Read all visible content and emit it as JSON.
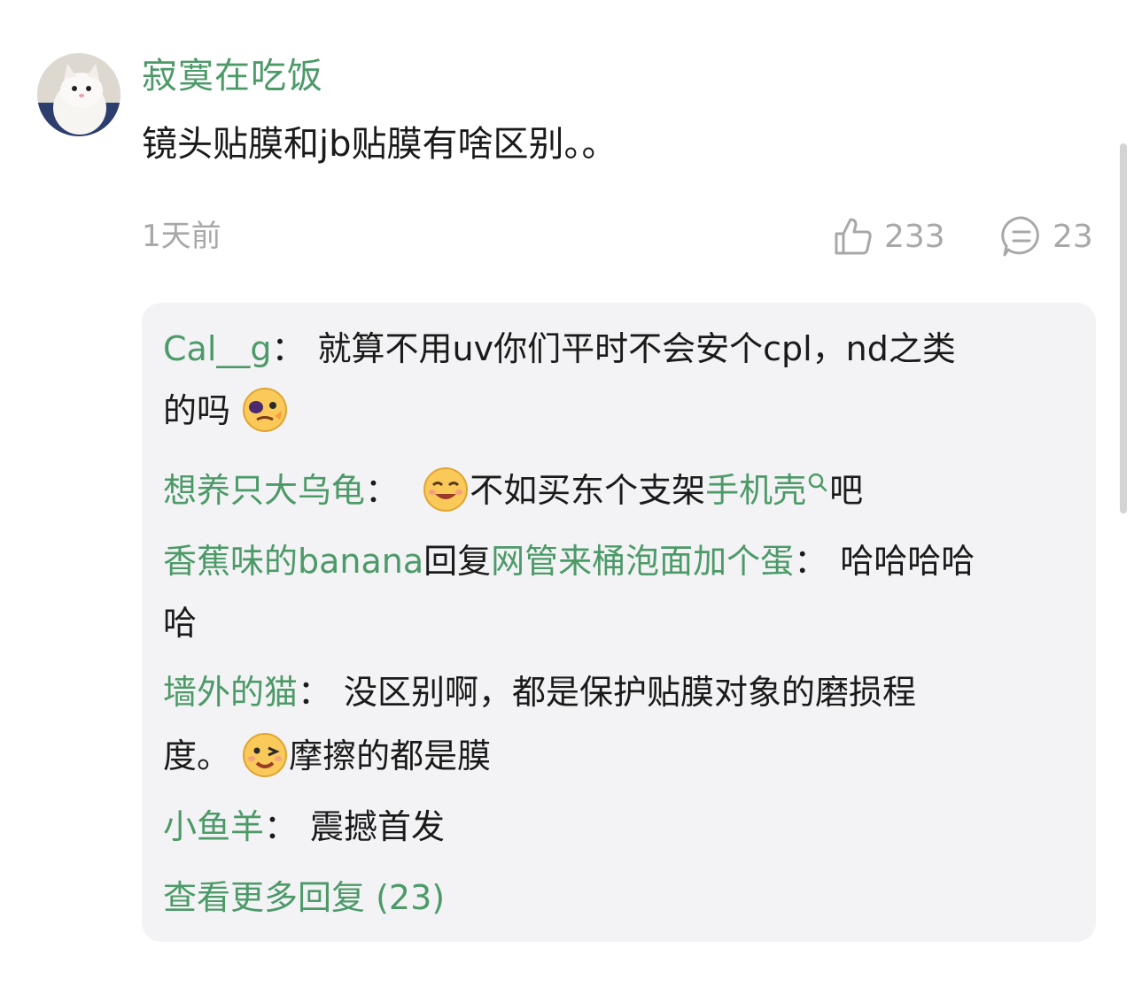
{
  "comment": {
    "author": "寂寞在吃饭",
    "text": "镜头贴膜和jb贴膜有啥区别。。",
    "time": "1天前",
    "likes": "233",
    "replies_count": "23"
  },
  "replies": [
    {
      "user": "Cal__g",
      "colon": "：",
      "text_line1": "就算不用uv你们平时不会安个cpl，nd之类",
      "text_line2": "的吗",
      "emoji": "heartbroken-face-emoji"
    },
    {
      "user": "想养只大乌龟",
      "colon": "：",
      "text": "不如买东个支架",
      "link": "手机壳",
      "after": "吧",
      "emoji": "grinning-face-emoji"
    },
    {
      "user": "香蕉味的banana",
      "reply_word": "回复",
      "target": "网管来桶泡面加个蛋",
      "colon": "：",
      "text_line1": "哈哈哈哈",
      "text_line2": "哈"
    },
    {
      "user": "墙外的猫",
      "colon": "：",
      "text_line1": "没区别啊，都是保护贴膜对象的磨损程",
      "text_line2_a": "度。",
      "text_line2_b": "摩擦的都是膜",
      "emoji": "winking-face-emoji"
    },
    {
      "user": "小鱼羊",
      "colon": "：",
      "text": "震撼首发"
    }
  ],
  "more_label": "查看更多回复 (23)",
  "icons": {
    "like": "thumbs-up-icon",
    "comment": "comment-bubble-icon",
    "search": "search-icon"
  },
  "colors": {
    "accent": "#4c9a68",
    "muted": "#a8a8a8",
    "panel": "#f3f3f5"
  }
}
